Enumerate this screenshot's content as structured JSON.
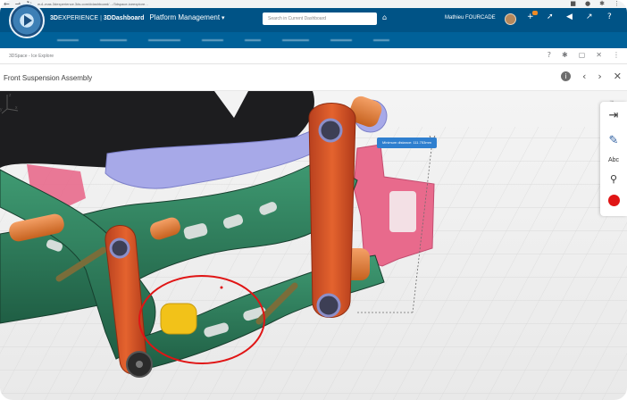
{
  "browser": {
    "back": "←",
    "forward": "→",
    "reload": "↻",
    "url": "eu1-mas.3dexperience.3ds.com/#dashboard/…/3dspace-iceexplore…",
    "ext_icons": [
      "■",
      "●",
      "✱",
      "⋮"
    ]
  },
  "app_bar": {
    "brand_3d": "3D",
    "brand_experience": "EXPERIENCE",
    "brand_dashboard": "3DDashboard",
    "brand_app": "Platform Management",
    "brand_caret": "▾",
    "search_placeholder": "Search in Current Dashboard",
    "tag_icon": "⌂",
    "user_name": "Mathieu FOURCADE",
    "icons": [
      "+",
      "➚",
      "◀",
      "↗",
      "?"
    ]
  },
  "tab_strip": {
    "tabs": [
      "▬▬▬▬",
      "▬▬▬▬▬",
      "▬▬▬▬▬▬",
      "▬▬▬▬",
      "▬▬▬",
      "▬▬▬▬▬",
      "▬▬▬▬",
      "▬▬▬"
    ]
  },
  "widget": {
    "title": "3DSpace - Ice Explore",
    "tools": [
      "?",
      "✱",
      "▢",
      "✕",
      "⋮"
    ]
  },
  "viewer": {
    "title": "Front Suspension Assembly",
    "nav": {
      "info": "i",
      "prev": "‹",
      "next": "›",
      "close": "✕"
    },
    "expand_icon": "⤢"
  },
  "measurement": {
    "label": "Minimum distance: 111.753mm"
  },
  "tool_palette": {
    "tools": [
      {
        "icon": "⇥"
      },
      {
        "icon": "✎"
      },
      {
        "icon": "Abc"
      },
      {
        "icon": "⚲"
      }
    ],
    "active_color": "#e01515"
  },
  "axes": {
    "x": "x",
    "y": "y",
    "z": "z"
  },
  "colors": {
    "brand_blue": "#005386",
    "frame_green": "#2f7c5a",
    "link_orange": "#d9552a",
    "bracket_pink": "#e86a8c",
    "highlight_red": "#e01515",
    "measure_blue": "#2f7fcf"
  }
}
